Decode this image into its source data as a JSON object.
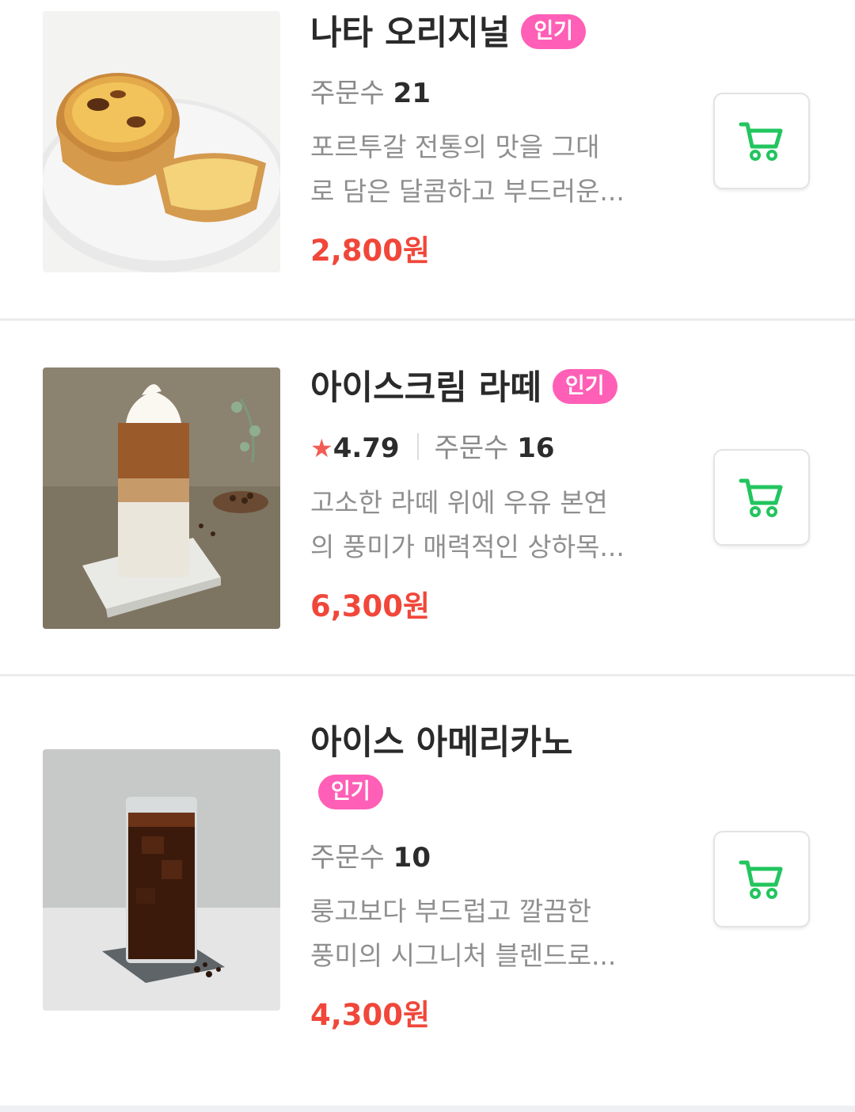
{
  "menu_items": [
    {
      "name": "나타 오리지널",
      "badge": "인기",
      "order_label": "주문수",
      "order_count": "21",
      "description_line1": "포르투갈 전통의 맛을 그대",
      "description_line2": "로 담은 달콤하고 부드러운...",
      "price": "2,800원",
      "image": "egg-tart-photo"
    },
    {
      "name": "아이스크림 라떼",
      "badge": "인기",
      "rating_icon": "★",
      "rating": "4.79",
      "order_label": "주문수",
      "order_count": "16",
      "description_line1": "고소한 라떼 위에 우유 본연",
      "description_line2": "의 풍미가 매력적인 상하목...",
      "price": "6,300원",
      "image": "ice-cream-latte-photo"
    },
    {
      "name": "아이스 아메리카노",
      "badge": "인기",
      "order_label": "주문수",
      "order_count": "10",
      "description_line1": "룽고보다 부드럽고 깔끔한",
      "description_line2": "풍미의 시그니처 블렌드로...",
      "price": "4,300원",
      "image": "iced-americano-photo"
    }
  ],
  "colors": {
    "badge": "#ff5fb6",
    "price": "#f0473a",
    "cart_icon": "#22c55e",
    "star": "#f25c54"
  },
  "icons": {
    "cart": "shopping-cart-icon"
  }
}
